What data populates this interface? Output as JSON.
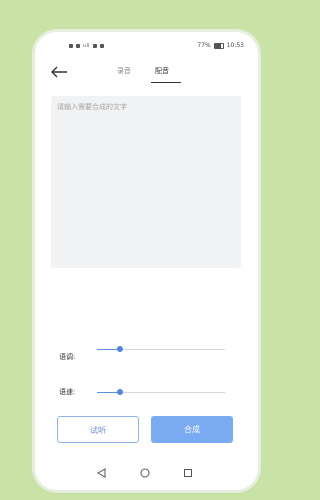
{
  "status_bar": {
    "left_text": "■ ■ ·· ■■",
    "battery": "77%",
    "time": "10:53"
  },
  "nav": {
    "back_icon": "arrow-left-icon",
    "tabs": [
      {
        "label": "录音",
        "active": false
      },
      {
        "label": "配音",
        "active": true
      }
    ]
  },
  "editor": {
    "placeholder": "请输入需要合成的文字",
    "value": ""
  },
  "controls": {
    "pitch": {
      "label": "语调:",
      "value": 0.18
    },
    "speed": {
      "label": "语速:",
      "value": 0.18
    }
  },
  "buttons": {
    "preview": "试听",
    "synthesize": "合成"
  },
  "system_nav": {
    "back": "triangle-back-icon",
    "home": "circle-home-icon",
    "recent": "square-recent-icon"
  },
  "colors": {
    "background": "#c9e2a5",
    "accent": "#7aaaf2",
    "slider": "#4f85de"
  }
}
